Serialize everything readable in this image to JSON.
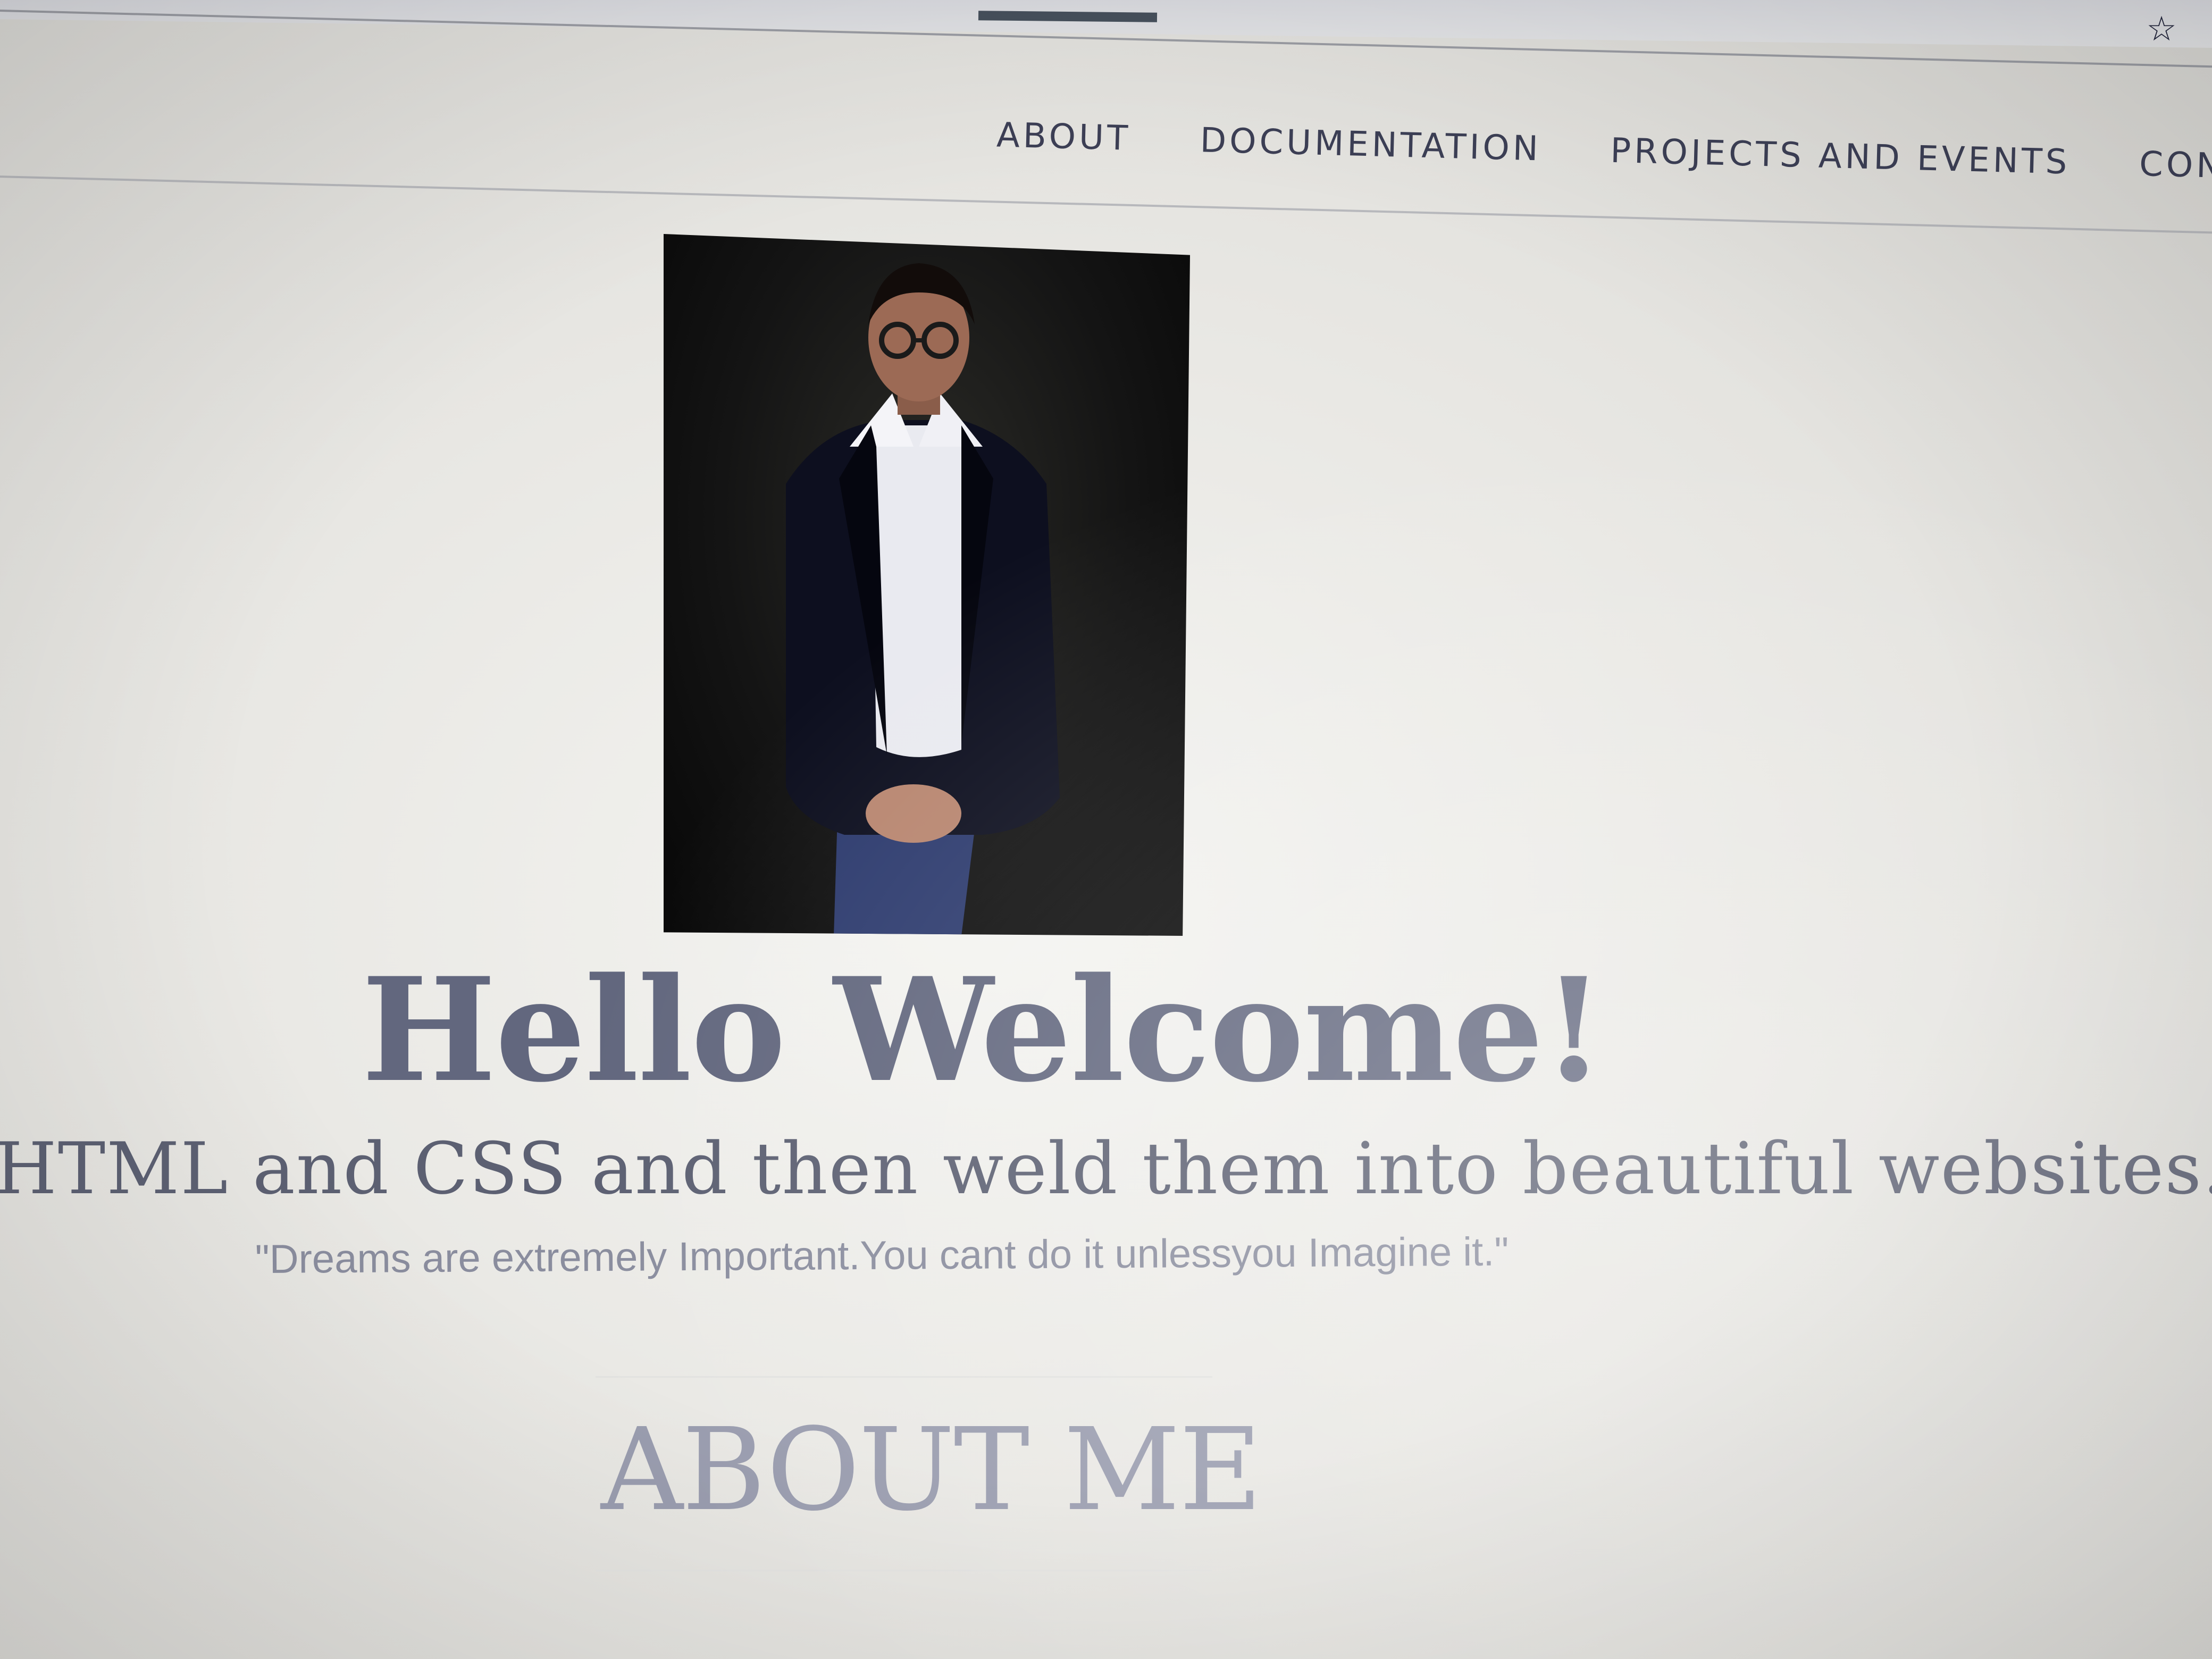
{
  "browser": {
    "bookmark_icon": "star-outline-icon"
  },
  "nav": {
    "items": [
      {
        "label": "ABOUT"
      },
      {
        "label": "DOCUMENTATION"
      },
      {
        "label": "PROJECTS AND EVENTS"
      },
      {
        "label": "CONTA"
      }
    ]
  },
  "hero": {
    "photo_alt": "profile photo",
    "title": "Hello Welcome!",
    "tagline": "HTML and CSS and then weld them into beautiful websites.",
    "quote": "\"Dreams are extremely Important.You cant do it unlessyou Imagine it.\""
  },
  "about": {
    "title": "ABOUT ME"
  },
  "colors": {
    "nav_text": "#3c3f55",
    "heading": "#62677e",
    "quote": "#8a8d9e",
    "section_title": "#9a9daf",
    "tab_indicator": "#46505c"
  }
}
